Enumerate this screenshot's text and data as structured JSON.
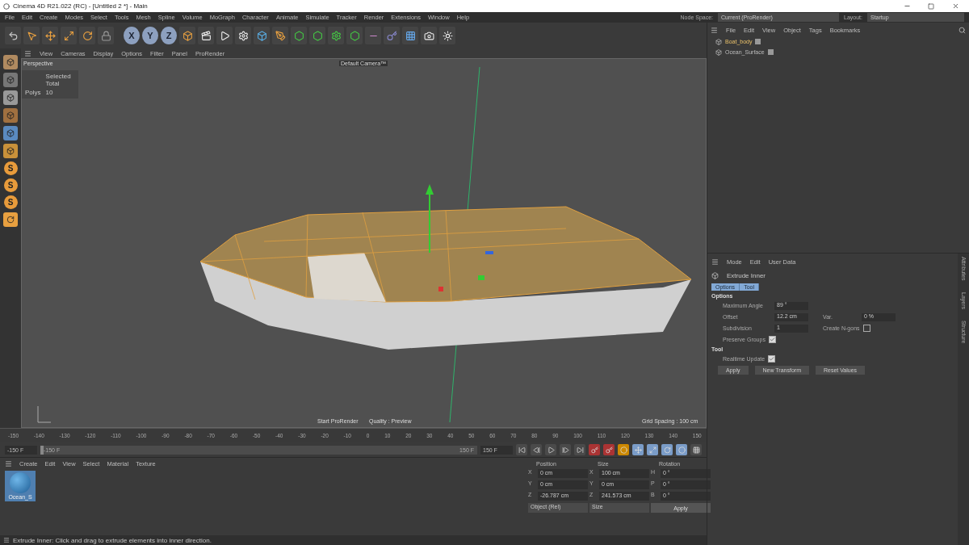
{
  "window": {
    "title": "Cinema 4D R21.022 (RC) - [Untitled 2 *] - Main"
  },
  "menu": [
    "File",
    "Edit",
    "Create",
    "Modes",
    "Select",
    "Tools",
    "Mesh",
    "Spline",
    "Volume",
    "MoGraph",
    "Character",
    "Animate",
    "Simulate",
    "Tracker",
    "Render",
    "Extensions",
    "Window",
    "Help"
  ],
  "node_space": {
    "label": "Node Space:",
    "value": "Current (ProRender)"
  },
  "layout": {
    "label": "Layout:",
    "value": "Startup"
  },
  "axis_buttons": [
    "X",
    "Y",
    "Z"
  ],
  "side_letters": [
    "S",
    "S",
    "S"
  ],
  "viewport": {
    "menu": [
      "View",
      "Cameras",
      "Display",
      "Options",
      "Filter",
      "Panel",
      "ProRender"
    ],
    "view_name": "Perspective",
    "camera": "Default Camera™",
    "hud_header": "Selected Total",
    "hud_label": "Polys",
    "hud_value": "10",
    "prorender": "Start ProRender",
    "quality": "Quality : Preview",
    "grid": "Grid Spacing : 100 cm"
  },
  "timeline": {
    "ticks": [
      "-150",
      "-140",
      "-130",
      "-120",
      "-110",
      "-100",
      "-90",
      "-80",
      "-70",
      "-60",
      "-50",
      "-40",
      "-30",
      "-20",
      "-10",
      "0",
      "10",
      "20",
      "30",
      "40",
      "50",
      "60",
      "70",
      "80",
      "90",
      "100",
      "110",
      "120",
      "130",
      "140",
      "150"
    ],
    "current": "-150 F",
    "range_start": "-150 F",
    "range_end": "150 F",
    "end": "150 F",
    "level": 0
  },
  "materials": {
    "menu": [
      "Create",
      "Edit",
      "View",
      "Select",
      "Material",
      "Texture"
    ],
    "items": [
      {
        "name": "Ocean_S"
      }
    ]
  },
  "coordinates": {
    "headers": [
      "Position",
      "Size",
      "Rotation"
    ],
    "rows": [
      {
        "axis": "X",
        "position": "0 cm",
        "size_axis": "X",
        "size": "100 cm",
        "rot_axis": "H",
        "rotation": "0 °"
      },
      {
        "axis": "Y",
        "position": "0 cm",
        "size_axis": "Y",
        "size": "0 cm",
        "rot_axis": "P",
        "rotation": "0 °"
      },
      {
        "axis": "Z",
        "position": "-26.787 cm",
        "size_axis": "Z",
        "size": "241.573 cm",
        "rot_axis": "B",
        "rotation": "0 °"
      }
    ],
    "mode": "Object (Rel)",
    "size_mode": "Size",
    "apply": "Apply"
  },
  "objects": {
    "menu": [
      "File",
      "Edit",
      "View",
      "Object",
      "Tags",
      "Bookmarks"
    ],
    "items": [
      {
        "name": "Boat_body",
        "selected": true
      },
      {
        "name": "Ocean_Surface",
        "selected": false
      }
    ]
  },
  "attributes": {
    "menu": [
      "Mode",
      "Edit",
      "User Data"
    ],
    "tool": "Extrude Inner",
    "tabs": [
      {
        "label": "Options",
        "selected": true
      },
      {
        "label": "Tool",
        "selected": true
      }
    ],
    "options_title": "Options",
    "max_angle": {
      "label": "Maximum Angle",
      "value": "89 °"
    },
    "offset": {
      "label": "Offset",
      "value": "12.2 cm"
    },
    "var": {
      "label": "Var.",
      "value": "0 %"
    },
    "subdivision": {
      "label": "Subdivision",
      "value": "1"
    },
    "ngons": {
      "label": "Create N-gons",
      "checked": false
    },
    "preserve": {
      "label": "Preserve Groups",
      "checked": true
    },
    "tool_title": "Tool",
    "realtime": {
      "label": "Realtime Update",
      "checked": true
    },
    "buttons": [
      "Apply",
      "New Transform",
      "Reset Values"
    ]
  },
  "side_tabs": [
    "Attributes",
    "Layers",
    "Structure"
  ],
  "status": "Extrude Inner: Click and drag to extrude elements into inner direction."
}
